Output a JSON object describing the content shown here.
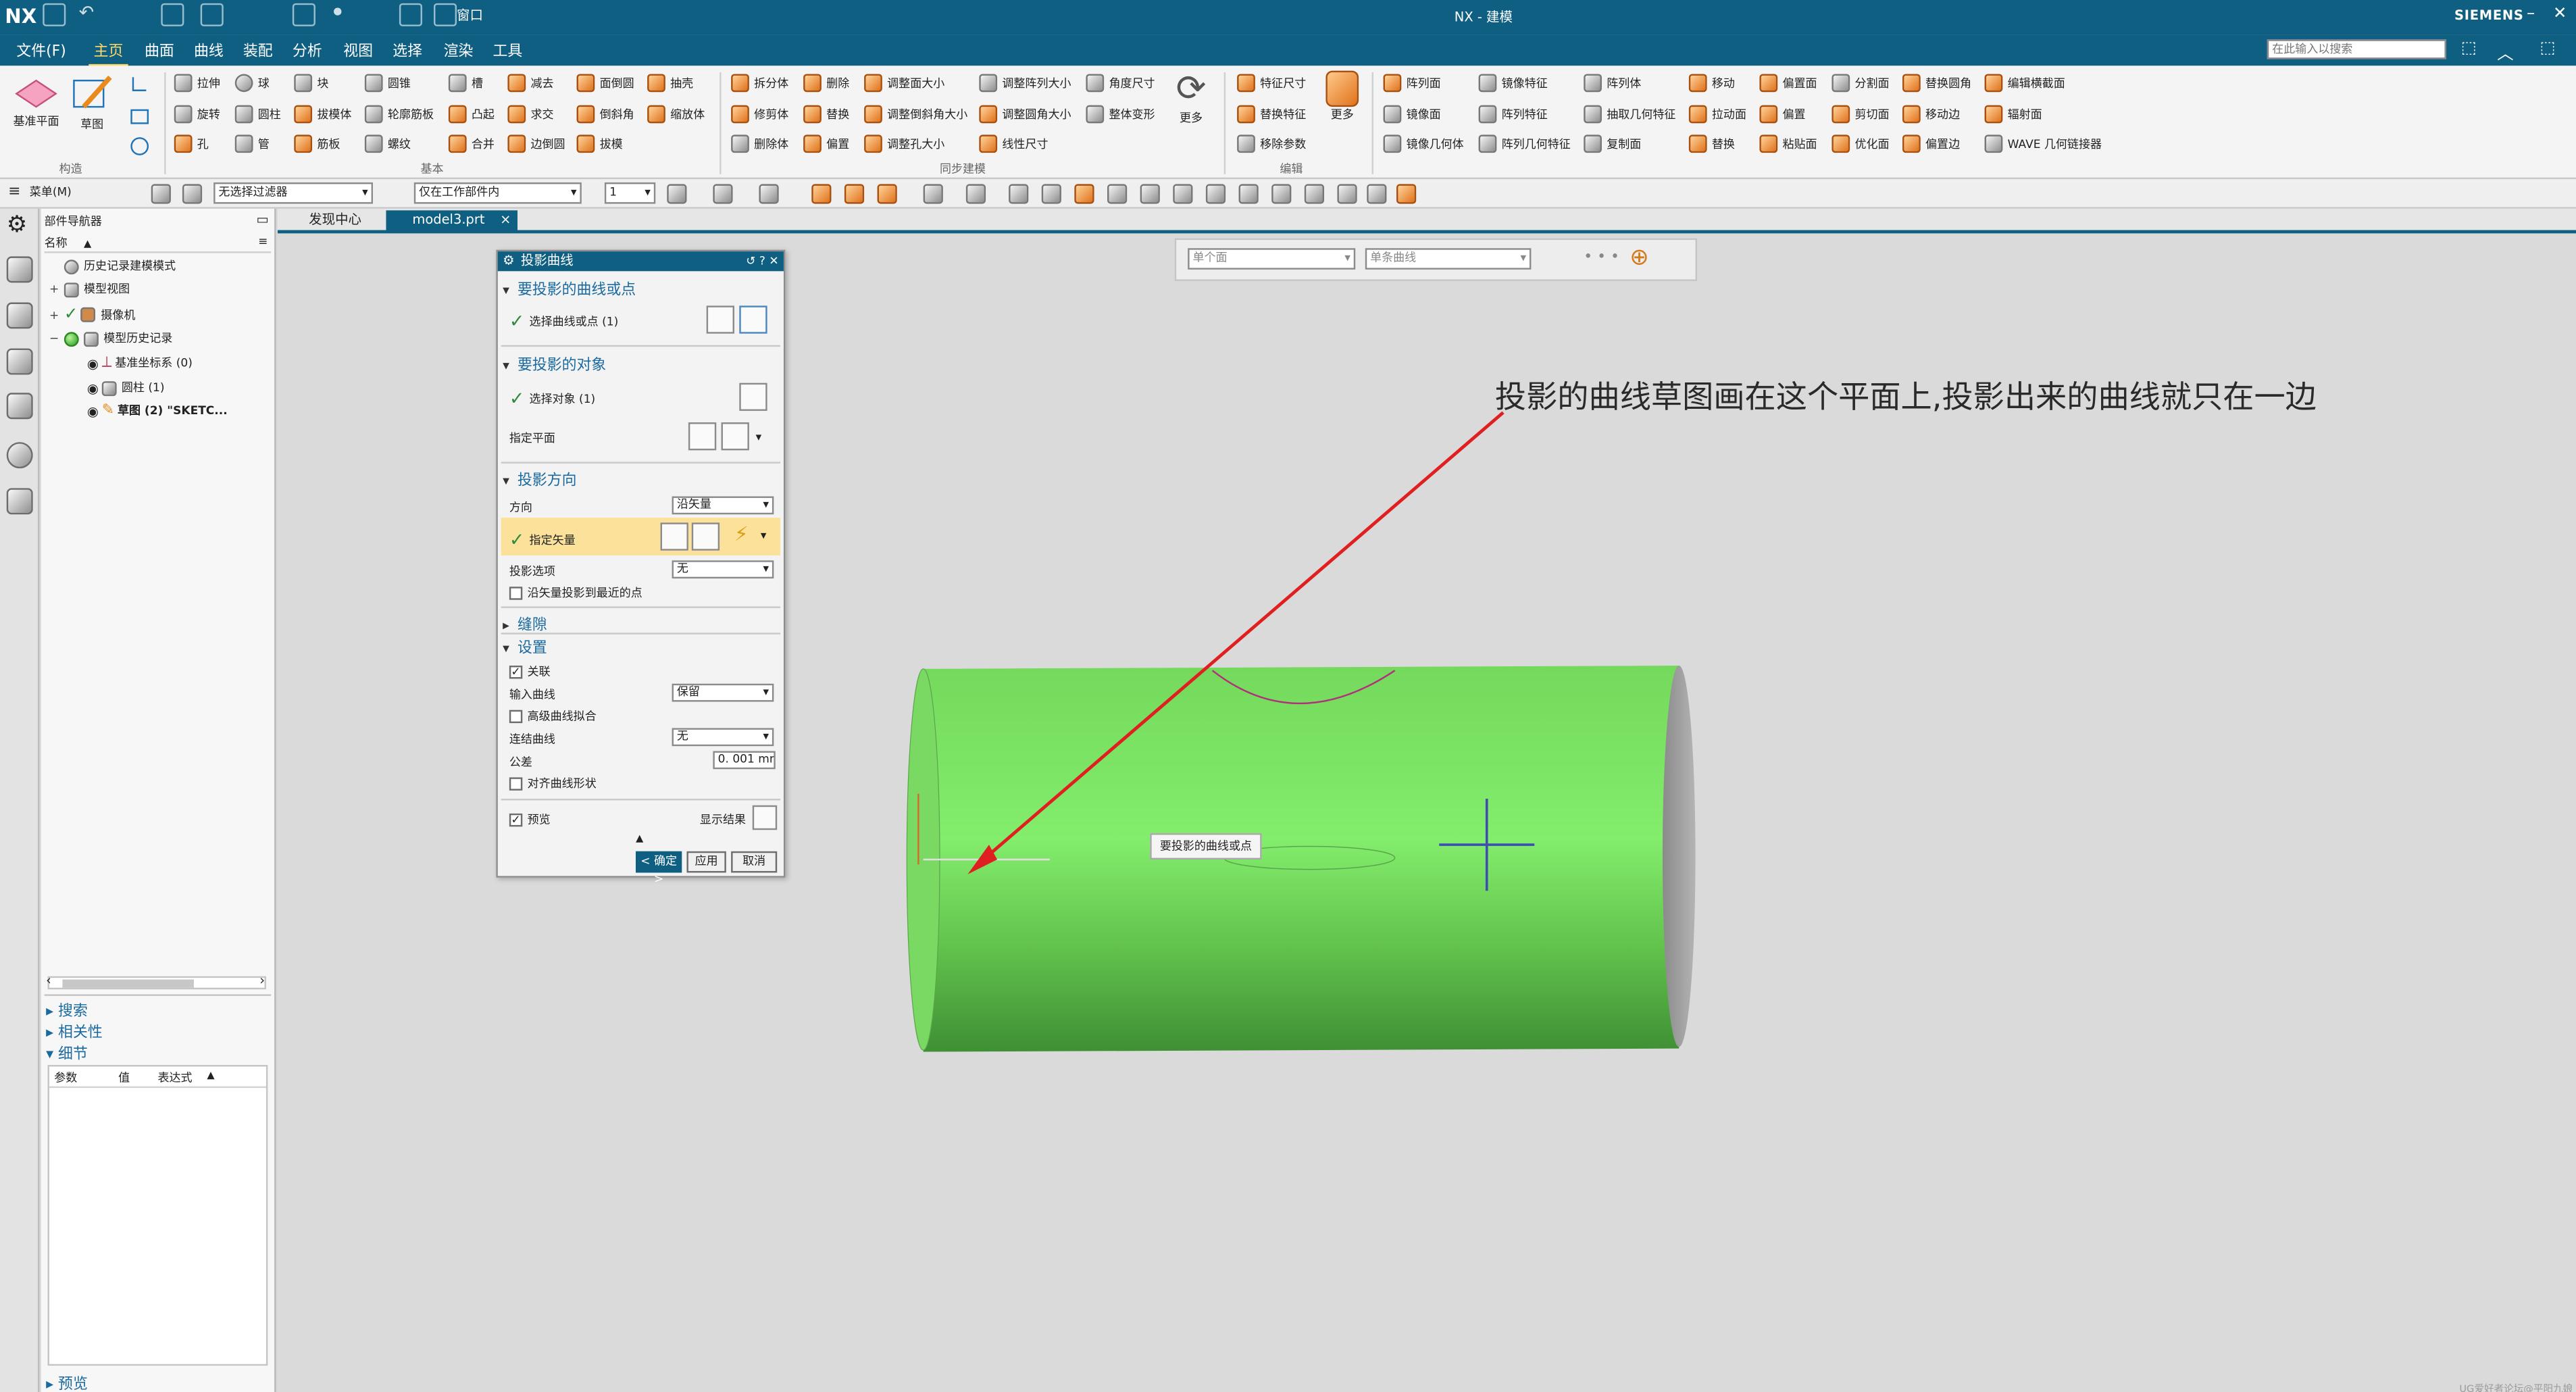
{
  "titlebar": {
    "app_logo": "NX",
    "window_menu": "窗口",
    "title": "NX - 建模",
    "brand": "SIEMENS",
    "minimize": "–",
    "maximize": "□",
    "close": "✕"
  },
  "menu": {
    "file": "文件(F)",
    "tabs": [
      "主页",
      "曲面",
      "曲线",
      "装配",
      "分析",
      "视图",
      "选择",
      "渲染",
      "工具"
    ],
    "search_placeholder": "在此输入以搜索"
  },
  "ribbon": {
    "construct": {
      "datum_plane": "基准平面",
      "sketch": "草图",
      "group": "构造"
    },
    "basic": {
      "items": [
        "拉伸",
        "球",
        "块",
        "圆锥",
        "槽",
        "减去",
        "面倒圆",
        "抽壳",
        "旋转",
        "圆柱",
        "拔模体",
        "轮廓筋板",
        "凸起",
        "求交",
        "倒斜角",
        "缩放体",
        "孔",
        "管",
        "筋板",
        "螺纹",
        "合并",
        "边倒圆",
        "拔模"
      ],
      "group": "基本"
    },
    "sync": {
      "items": [
        "拆分体",
        "删除",
        "调整面大小",
        "调整阵列大小",
        "角度尺寸",
        "修剪体",
        "替换",
        "调整倒斜角大小",
        "调整圆角大小",
        "整体变形",
        "删除体",
        "偏置",
        "调整孔大小",
        "线性尺寸"
      ],
      "more": "更多",
      "group": "同步建模"
    },
    "edit": {
      "items": [
        "特征尺寸",
        "替换特征",
        "移除参数"
      ],
      "more": "更多",
      "group": "编辑"
    },
    "right": {
      "items": [
        "阵列面",
        "镜像特征",
        "阵列体",
        "移动",
        "偏置面",
        "分割面",
        "替换圆角",
        "编辑横截面",
        "镜像面",
        "阵列特征",
        "抽取几何特征",
        "拉动面",
        "偏置",
        "剪切面",
        "移动边",
        "辐射面",
        "镜像几何体",
        "阵列几何特征",
        "复制面",
        "替换",
        "粘贴面",
        "优化面",
        "偏置边",
        "WAVE 几何链接器"
      ]
    }
  },
  "selection_bar": {
    "menu": "菜单(M)",
    "filter": "无选择过滤器",
    "scope": "仅在工作部件内",
    "value": "1"
  },
  "navigator": {
    "title": "部件导航器",
    "column_name": "名称",
    "nodes": [
      "历史记录建模模式",
      "模型视图",
      "摄像机",
      "模型历史记录",
      "基准坐标系 (0)",
      "圆柱 (1)",
      "草图 (2) \"SKETC..."
    ],
    "sections": {
      "search": "搜索",
      "relevance": "相关性",
      "details": "细节",
      "preview": "预览"
    },
    "details_cols": [
      "参数",
      "值",
      "表达式"
    ]
  },
  "doc_tabs": [
    "发现中心",
    "model3.prt"
  ],
  "dialog": {
    "title": "投影曲线",
    "sec_curves": "要投影的曲线或点",
    "select_curves": "选择曲线或点 (1)",
    "sec_objects": "要投影的对象",
    "select_objects": "选择对象 (1)",
    "specify_plane": "指定平面",
    "sec_direction": "投影方向",
    "direction_label": "方向",
    "direction_value": "沿矢量",
    "specify_vector": "指定矢量",
    "projection_option_label": "投影选项",
    "projection_option_value": "无",
    "nearest_point": "沿矢量投影到最近的点",
    "sec_gap": "缝隙",
    "sec_settings": "设置",
    "associative": "关联",
    "input_curve_label": "输入曲线",
    "input_curve_value": "保留",
    "advanced_fit": "高级曲线拟合",
    "connect_curve_label": "连结曲线",
    "connect_curve_value": "无",
    "tolerance_label": "公差",
    "tolerance_value": "0. 001",
    "tolerance_unit": "mm",
    "align_shape": "对齐曲线形状",
    "preview": "预览",
    "show_result": "显示结果",
    "ok": "< 确定 >",
    "apply": "应用",
    "cancel": "取消"
  },
  "graphics": {
    "top_filter_1": "单个面",
    "top_filter_2": "单条曲线",
    "annotation": "投影的曲线草图画在这个平面上,投影出来的曲线就只在一边",
    "tooltip": "要投影的曲线或点",
    "watermark": "UG爱好者论坛@平阳九娘"
  },
  "colors": {
    "title_blue": "#0f5f83",
    "cylinder_green": "#6ed35a",
    "arrow_red": "#e02020",
    "highlight_yellow": "#fbe199"
  }
}
